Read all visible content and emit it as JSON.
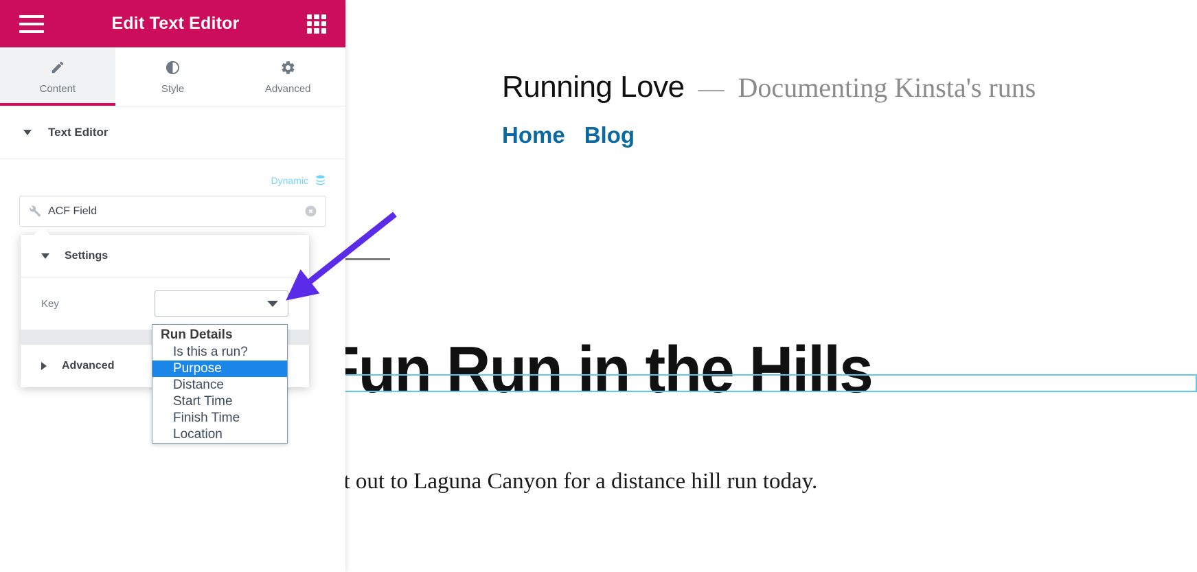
{
  "panel": {
    "header": {
      "title": "Edit Text Editor",
      "menu_icon": "hamburger-menu-icon",
      "apps_icon": "grid-apps-icon"
    },
    "tabs": [
      {
        "label": "Content",
        "icon": "pencil-icon",
        "active": true
      },
      {
        "label": "Style",
        "icon": "contrast-circle-icon",
        "active": false
      },
      {
        "label": "Advanced",
        "icon": "gear-icon",
        "active": false
      }
    ],
    "widget_section": {
      "label": "Text Editor",
      "expanded": true
    },
    "dynamic": {
      "label": "Dynamic",
      "icon": "database-stack-icon",
      "color": "#71d7f7"
    },
    "acf_field": {
      "text": "ACF Field",
      "left_icon": "wrench-icon",
      "clear_icon": "clear-circle-x-icon"
    }
  },
  "popover": {
    "settings": {
      "label": "Settings",
      "expanded": true
    },
    "key_control": {
      "label": "Key",
      "value": "",
      "caret_icon": "chevron-down-icon"
    },
    "advanced": {
      "label": "Advanced",
      "expanded": false
    }
  },
  "dropdown": {
    "optgroup": "Run Details",
    "options": [
      {
        "label": "Is this a run?",
        "selected": false
      },
      {
        "label": "Purpose",
        "selected": true
      },
      {
        "label": "Distance",
        "selected": false
      },
      {
        "label": "Start Time",
        "selected": false
      },
      {
        "label": "Finish Time",
        "selected": false
      },
      {
        "label": "Location",
        "selected": false
      }
    ],
    "highlight_color": "#1a86e8"
  },
  "preview": {
    "site_title": "Running Love",
    "site_dash": "—",
    "site_tagline": "Documenting Kinsta's runs",
    "nav": [
      {
        "label": "Home"
      },
      {
        "label": "Blog"
      }
    ],
    "post_title": "Fun Run in the Hills",
    "post_body": "set out to Laguna Canyon for a distance hill run today.",
    "quote_mark": "‹",
    "link_color": "#0a6aa1",
    "widget_outline_color": "#5ec8f2"
  },
  "annotation": {
    "arrow_color": "#5b2ce8"
  }
}
